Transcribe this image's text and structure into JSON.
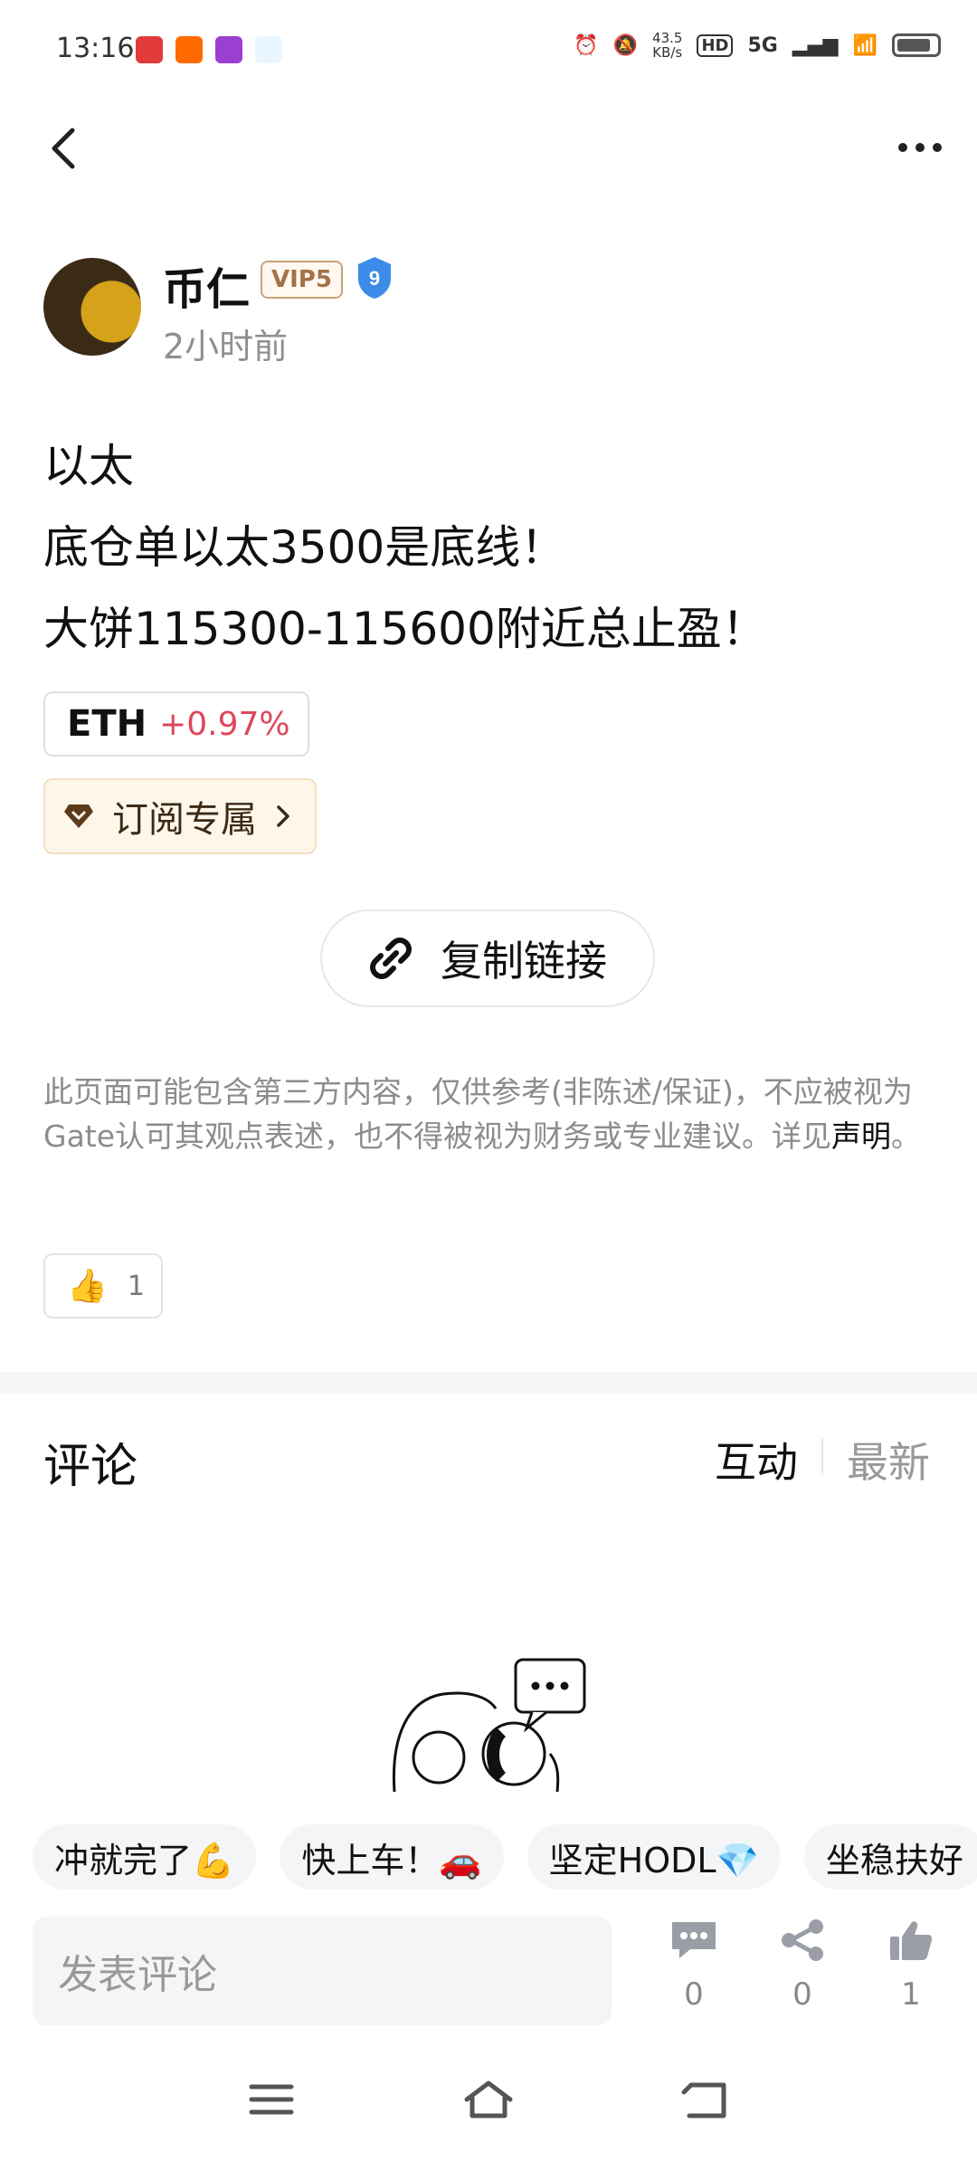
{
  "status_bar": {
    "time": "13:16",
    "net_speed": "43.5",
    "net_unit": "KB/s",
    "hd": "HD",
    "network": "5G"
  },
  "author": {
    "name": "币仁",
    "vip_badge": "VIP5",
    "level": "9",
    "time_ago": "2小时前"
  },
  "post": {
    "lines": [
      "以太",
      "底仓单以太3500是底线！",
      "大饼115300-115600附近总止盈！"
    ]
  },
  "coin_tag": {
    "symbol": "ETH",
    "change": "+0.97%"
  },
  "subscribe_label": "订阅专属",
  "copy_link_label": "复制链接",
  "disclaimer": {
    "text": "此页面可能包含第三方内容，仅供参考(非陈述/保证)，不应被视为Gate认可其观点表述，也不得被视为财务或专业建议。详见",
    "link": "声明",
    "end": "。"
  },
  "reaction": {
    "emoji": "👍",
    "count": "1"
  },
  "comments": {
    "title": "评论",
    "sort_interact": "互动",
    "sort_latest": "最新"
  },
  "quick_replies": [
    "冲就完了💪",
    "快上车！🚗",
    "坚定HODL💎",
    "坐稳扶好"
  ],
  "bottom_bar": {
    "input_placeholder": "发表评论",
    "comment_count": "0",
    "share_count": "0",
    "like_count": "1"
  },
  "colors": {
    "positive": "#e0455a",
    "muted": "#8c8c8c",
    "vip": "#a47245"
  }
}
